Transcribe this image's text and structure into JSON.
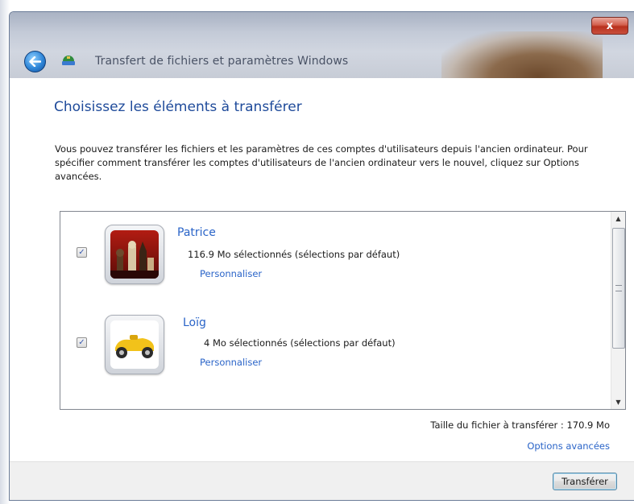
{
  "window": {
    "title": "Transfert de fichiers et paramètres Windows",
    "close_label": "x"
  },
  "page": {
    "heading": "Choisissez les éléments à transférer",
    "description": "Vous pouvez transférer les fichiers et les paramètres de ces comptes d'utilisateurs depuis l'ancien ordinateur. Pour spécifier comment transférer les comptes d'utilisateurs de l'ancien ordinateur vers le nouvel, cliquez sur Options avancées."
  },
  "users": [
    {
      "name": "Patrice",
      "checked": true,
      "size": "116.9  Mo sélectionnés (sélections par défaut)",
      "customize_label": "Personnaliser",
      "avatar": "chess-pieces"
    },
    {
      "name": "Loïg",
      "checked": true,
      "size": "4  Mo sélectionnés (sélections par défaut)",
      "customize_label": "Personnaliser",
      "avatar": "race-car"
    }
  ],
  "summary": {
    "total_label": "Taille du fichier à transférer :  170.9 Mo",
    "advanced_options": "Options avancées"
  },
  "footer": {
    "transfer_button": "Transférer"
  },
  "icons": {
    "back": "back-arrow-icon",
    "app": "transfer-icon"
  },
  "colors": {
    "heading": "#1e4a9a",
    "link": "#2a64c8",
    "close": "#c9503e"
  }
}
